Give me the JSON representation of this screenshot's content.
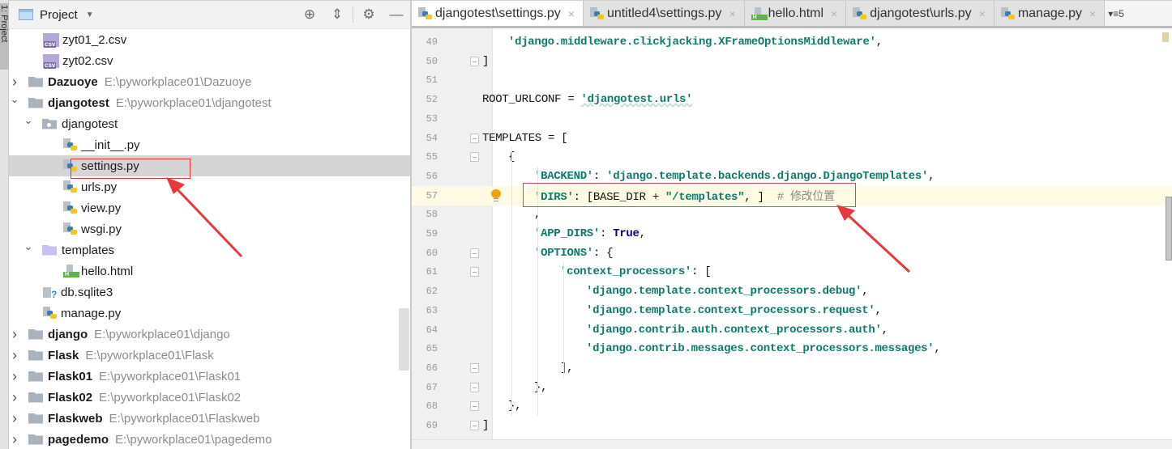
{
  "tool_strip": {
    "label": "1: Project"
  },
  "project_panel": {
    "title": "Project",
    "tools": [
      {
        "name": "locate-icon",
        "glyph": "⊕"
      },
      {
        "name": "collapse-all-icon",
        "glyph": "⇕"
      },
      {
        "name": "gear-icon",
        "glyph": "⚙"
      },
      {
        "name": "minimize-icon",
        "glyph": "—"
      }
    ],
    "tree": [
      {
        "label": "zyt01_2.csv",
        "type": "csv"
      },
      {
        "label": "zyt02.csv",
        "type": "csv"
      },
      {
        "label": "Dazuoye",
        "path": "E:\\pyworkplace01\\Dazuoye",
        "type": "project",
        "expanded": false
      },
      {
        "label": "djangotest",
        "path": "E:\\pyworkplace01\\djangotest",
        "type": "project",
        "expanded": true
      },
      {
        "label": "djangotest",
        "type": "package",
        "expanded": true
      },
      {
        "label": "__init__.py",
        "type": "py"
      },
      {
        "label": "settings.py",
        "type": "py",
        "selected": true
      },
      {
        "label": "urls.py",
        "type": "py"
      },
      {
        "label": "view.py",
        "type": "py"
      },
      {
        "label": "wsgi.py",
        "type": "py"
      },
      {
        "label": "templates",
        "type": "template-folder",
        "expanded": true
      },
      {
        "label": "hello.html",
        "type": "html"
      },
      {
        "label": "db.sqlite3",
        "type": "db"
      },
      {
        "label": "manage.py",
        "type": "py"
      },
      {
        "label": "django",
        "path": "E:\\pyworkplace01\\django",
        "type": "project",
        "expanded": false
      },
      {
        "label": "Flask",
        "path": "E:\\pyworkplace01\\Flask",
        "type": "project",
        "expanded": false
      },
      {
        "label": "Flask01",
        "path": "E:\\pyworkplace01\\Flask01",
        "type": "project",
        "expanded": false
      },
      {
        "label": "Flask02",
        "path": "E:\\pyworkplace01\\Flask02",
        "type": "project",
        "expanded": false
      },
      {
        "label": "Flaskweb",
        "path": "E:\\pyworkplace01\\Flaskweb",
        "type": "project",
        "expanded": false
      },
      {
        "label": "pagedemo",
        "path": "E:\\pyworkplace01\\pagedemo",
        "type": "project",
        "expanded": false
      }
    ]
  },
  "editor": {
    "tabs": [
      {
        "label": "djangotest\\settings.py",
        "icon": "py",
        "active": true
      },
      {
        "label": "untitled4\\settings.py",
        "icon": "py",
        "active": false
      },
      {
        "label": "hello.html",
        "icon": "html",
        "active": false
      },
      {
        "label": "djangotest\\urls.py",
        "icon": "py",
        "active": false
      },
      {
        "label": "manage.py",
        "icon": "py",
        "active": false
      }
    ],
    "more_tabs": "▾≡5",
    "lines": [
      {
        "n": "49",
        "indent": 1,
        "parts": [
          [
            "s",
            "'django.middleware.clickjacking.XFrameOptionsMiddleware'"
          ],
          [
            "p",
            ","
          ]
        ]
      },
      {
        "n": "50",
        "indent": 0,
        "fold": "end",
        "parts": [
          [
            "p",
            "]"
          ]
        ]
      },
      {
        "n": "51",
        "indent": 0,
        "parts": []
      },
      {
        "n": "52",
        "indent": 0,
        "parts": [
          [
            "p",
            "ROOT_URLCONF = "
          ],
          [
            "su",
            "'djangotest.urls'"
          ]
        ]
      },
      {
        "n": "53",
        "indent": 0,
        "parts": []
      },
      {
        "n": "54",
        "indent": 0,
        "fold": "start",
        "parts": [
          [
            "p",
            "TEMPLATES = ["
          ]
        ]
      },
      {
        "n": "55",
        "indent": 1,
        "fold": "start",
        "parts": [
          [
            "p",
            "{"
          ]
        ]
      },
      {
        "n": "56",
        "indent": 2,
        "parts": [
          [
            "s",
            "'BACKEND'"
          ],
          [
            "p",
            ": "
          ],
          [
            "s",
            "'django.template.backends.django.DjangoTemplates'"
          ],
          [
            "p",
            ","
          ]
        ]
      },
      {
        "n": "57",
        "indent": 2,
        "current": true,
        "bulb": true,
        "parts": [
          [
            "s",
            "'DIRS'"
          ],
          [
            "p",
            ": [BASE_DIR + "
          ],
          [
            "s",
            "\"/templates\""
          ],
          [
            "p",
            ", ]  "
          ],
          [
            "c",
            "# 修改位置"
          ]
        ]
      },
      {
        "n": "58",
        "indent": 2,
        "parts": [
          [
            "p",
            ","
          ]
        ]
      },
      {
        "n": "59",
        "indent": 2,
        "parts": [
          [
            "s",
            "'APP_DIRS'"
          ],
          [
            "p",
            ": "
          ],
          [
            "k",
            "True"
          ],
          [
            "p",
            ","
          ]
        ]
      },
      {
        "n": "60",
        "indent": 2,
        "fold": "start",
        "parts": [
          [
            "s",
            "'OPTIONS'"
          ],
          [
            "p",
            ": {"
          ]
        ]
      },
      {
        "n": "61",
        "indent": 3,
        "fold": "start",
        "parts": [
          [
            "s",
            "'context_processors'"
          ],
          [
            "p",
            ": ["
          ]
        ]
      },
      {
        "n": "62",
        "indent": 4,
        "parts": [
          [
            "s",
            "'django.template.context_processors.debug'"
          ],
          [
            "p",
            ","
          ]
        ]
      },
      {
        "n": "63",
        "indent": 4,
        "parts": [
          [
            "s",
            "'django.template.context_processors.request'"
          ],
          [
            "p",
            ","
          ]
        ]
      },
      {
        "n": "64",
        "indent": 4,
        "parts": [
          [
            "s",
            "'django.contrib.auth.context_processors.auth'"
          ],
          [
            "p",
            ","
          ]
        ]
      },
      {
        "n": "65",
        "indent": 4,
        "parts": [
          [
            "s",
            "'django.contrib.messages.context_processors.messages'"
          ],
          [
            "p",
            ","
          ]
        ]
      },
      {
        "n": "66",
        "indent": 3,
        "fold": "end",
        "parts": [
          [
            "p",
            "],"
          ]
        ]
      },
      {
        "n": "67",
        "indent": 2,
        "fold": "end",
        "parts": [
          [
            "p",
            "},"
          ]
        ]
      },
      {
        "n": "68",
        "indent": 1,
        "fold": "end",
        "parts": [
          [
            "p",
            "},"
          ]
        ]
      },
      {
        "n": "69",
        "indent": 0,
        "fold": "end",
        "parts": [
          [
            "p",
            "]"
          ]
        ]
      }
    ]
  },
  "annotations": {
    "color": "#e0343b",
    "items": [
      "selected-file-highlight",
      "dirs-setting-highlight"
    ]
  }
}
